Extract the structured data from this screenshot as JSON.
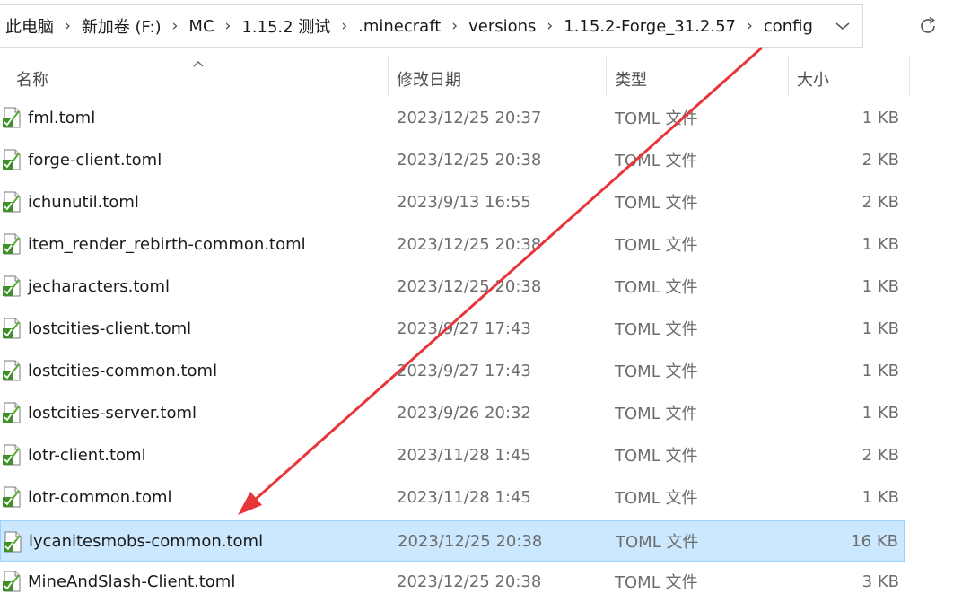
{
  "breadcrumb": [
    "此电脑",
    "新加卷 (F:)",
    "MC",
    "1.15.2 测试",
    ".minecraft",
    "versions",
    "1.15.2-Forge_31.2.57",
    "config"
  ],
  "separator": "›",
  "columns": {
    "name": "名称",
    "date": "修改日期",
    "type": "类型",
    "size": "大小"
  },
  "files": [
    {
      "name": "fml.toml",
      "date": "2023/12/25 20:37",
      "type": "TOML 文件",
      "size": "1 KB",
      "selected": false
    },
    {
      "name": "forge-client.toml",
      "date": "2023/12/25 20:38",
      "type": "TOML 文件",
      "size": "2 KB",
      "selected": false
    },
    {
      "name": "ichunutil.toml",
      "date": "2023/9/13 16:55",
      "type": "TOML 文件",
      "size": "2 KB",
      "selected": false
    },
    {
      "name": "item_render_rebirth-common.toml",
      "date": "2023/12/25 20:38",
      "type": "TOML 文件",
      "size": "1 KB",
      "selected": false
    },
    {
      "name": "jecharacters.toml",
      "date": "2023/12/25 20:38",
      "type": "TOML 文件",
      "size": "1 KB",
      "selected": false
    },
    {
      "name": "lostcities-client.toml",
      "date": "2023/9/27 17:43",
      "type": "TOML 文件",
      "size": "1 KB",
      "selected": false
    },
    {
      "name": "lostcities-common.toml",
      "date": "2023/9/27 17:43",
      "type": "TOML 文件",
      "size": "1 KB",
      "selected": false
    },
    {
      "name": "lostcities-server.toml",
      "date": "2023/9/26 20:32",
      "type": "TOML 文件",
      "size": "1 KB",
      "selected": false
    },
    {
      "name": "lotr-client.toml",
      "date": "2023/11/28 1:45",
      "type": "TOML 文件",
      "size": "2 KB",
      "selected": false
    },
    {
      "name": "lotr-common.toml",
      "date": "2023/11/28 1:45",
      "type": "TOML 文件",
      "size": "1 KB",
      "selected": false
    },
    {
      "name": "lycanitesmobs-common.toml",
      "date": "2023/12/25 20:38",
      "type": "TOML 文件",
      "size": "16 KB",
      "selected": true
    },
    {
      "name": "MineAndSlash-Client.toml",
      "date": "2023/12/25 20:38",
      "type": "TOML 文件",
      "size": "3 KB",
      "selected": false
    }
  ],
  "colors": {
    "selection_bg": "#cce8ff",
    "selection_border": "#99d1ff",
    "annotation_arrow": "#e8353a"
  }
}
